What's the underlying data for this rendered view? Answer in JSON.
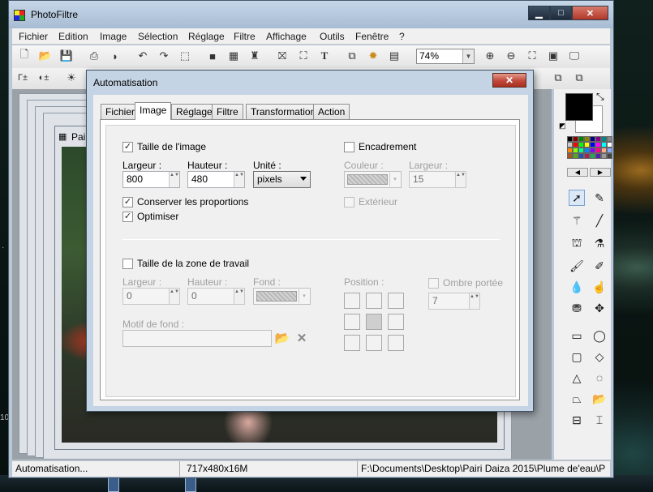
{
  "app": {
    "title": "PhotoFiltre"
  },
  "menu": [
    "Fichier",
    "Edition",
    "Image",
    "Sélection",
    "Réglage",
    "Filtre",
    "Affichage",
    "Outils",
    "Fenêtre",
    "?"
  ],
  "toolbar": {
    "zoom_value": "74%"
  },
  "document": {
    "title": "Pairi"
  },
  "statusbar": {
    "left": "Automatisation...",
    "size": "717x480x16M",
    "path": "F:\\Documents\\Desktop\\Pairi Daiza 2015\\Plume de'eau\\P"
  },
  "dialog": {
    "title": "Automatisation",
    "close_glyph": "✕",
    "tabs": [
      "Fichier",
      "Image",
      "Réglage",
      "Filtre",
      "Transformation",
      "Action"
    ],
    "active_tab": "Image",
    "image_size": {
      "checkbox_label": "Taille de l'image",
      "checked": true,
      "width_label": "Largeur :",
      "width_value": "800",
      "height_label": "Hauteur :",
      "height_value": "480",
      "unit_label": "Unité :",
      "unit_value": "pixels",
      "keep_ratio_label": "Conserver les proportions",
      "keep_ratio_checked": true,
      "optimize_label": "Optimiser",
      "optimize_checked": true
    },
    "frame": {
      "checkbox_label": "Encadrement",
      "checked": false,
      "color_label": "Couleur :",
      "width_label": "Largeur :",
      "width_value": "15",
      "exterior_label": "Extérieur",
      "exterior_checked": false
    },
    "workspace": {
      "checkbox_label": "Taille de la zone de travail",
      "checked": false,
      "width_label": "Largeur :",
      "width_value": "0",
      "height_label": "Hauteur :",
      "height_value": "0",
      "bg_label": "Fond :",
      "position_label": "Position :",
      "shadow_label": "Ombre portée",
      "shadow_checked": false,
      "shadow_value": "7",
      "pattern_label": "Motif de fond :"
    }
  },
  "icons": {
    "check": "✓",
    "spin": "▲▼",
    "dropdown": "▾"
  },
  "colors": {
    "accent_close": "#c0473a",
    "title_bar": "#a7bcd3"
  }
}
